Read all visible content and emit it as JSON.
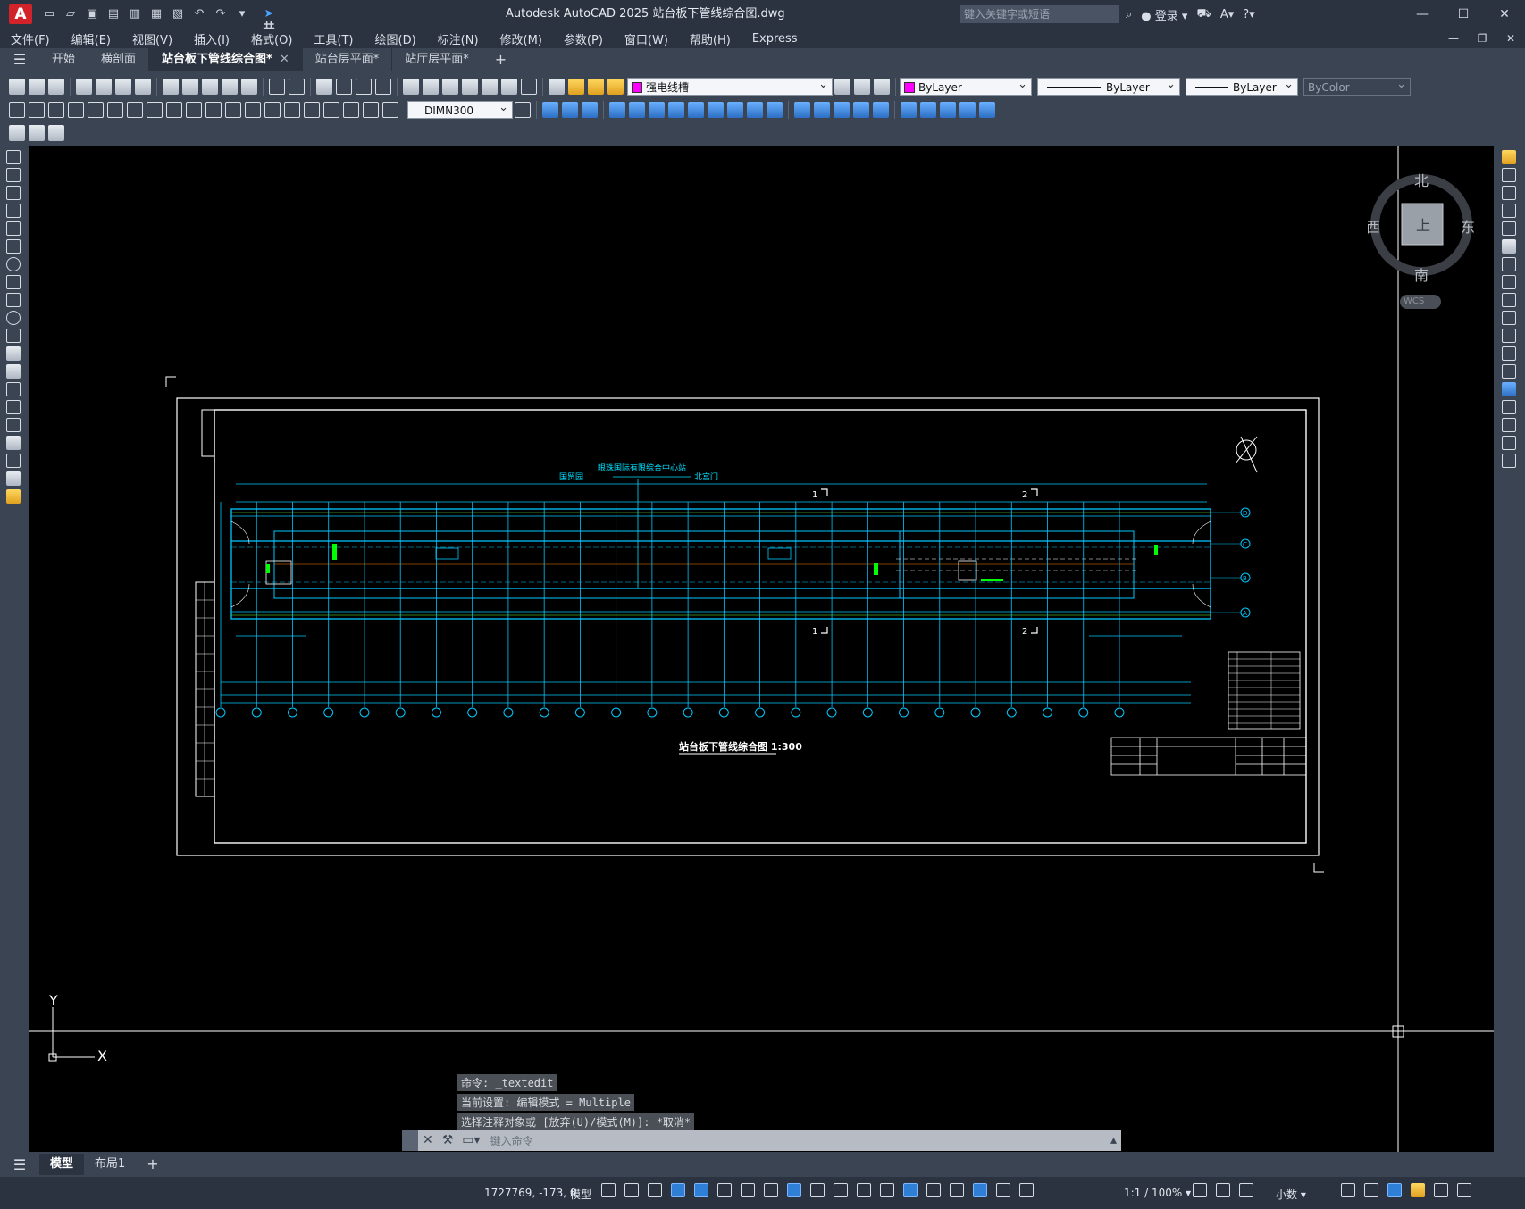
{
  "app": {
    "logo": "A",
    "title": "Autodesk AutoCAD 2025     站台板下管线综合图.dwg",
    "share_label": "共享",
    "search_placeholder": "键入关键字或短语",
    "login_label": "登录"
  },
  "menu": [
    "文件(F)",
    "编辑(E)",
    "视图(V)",
    "插入(I)",
    "格式(O)",
    "工具(T)",
    "绘图(D)",
    "标注(N)",
    "修改(M)",
    "参数(P)",
    "窗口(W)",
    "帮助(H)",
    "Express"
  ],
  "tabs": [
    {
      "label": "开始",
      "active": false
    },
    {
      "label": "横剖面",
      "active": false
    },
    {
      "label": "站台板下管线综合图*",
      "active": true
    },
    {
      "label": "站台层平面*",
      "active": false
    },
    {
      "label": "站厅层平面*",
      "active": false
    }
  ],
  "toolbar": {
    "layer_name": "强电线槽",
    "color": "ByLayer",
    "linetype": "ByLayer",
    "lineweight": "ByLayer",
    "plotstyle": "ByColor",
    "dimstyle": "DIMN300"
  },
  "viewcube": {
    "north": "北",
    "south": "南",
    "east": "东",
    "west": "西",
    "top": "上",
    "wcs": "WCS"
  },
  "drawing": {
    "title": "站台板下管线综合图 1:300",
    "top_label_left": "国贸园",
    "top_label_mid": "眼珠国际有限综合中心站",
    "top_label_right": "北宫门",
    "section1": "1",
    "section2": "2",
    "axis_labels": [
      "①",
      "②",
      "③",
      "④",
      "⑤",
      "⑥",
      "⑦",
      "⑧",
      "⑨",
      "⑩",
      "⑪",
      "⑫",
      "⑬",
      "⑭",
      "⑮",
      "⑯",
      "⑰",
      "⑱",
      "⑲",
      "⑳",
      "㉑",
      "㉒",
      "㉓",
      "㉔",
      "㉕",
      "㉖"
    ],
    "row_labels": [
      "D",
      "C",
      "B",
      "A"
    ]
  },
  "ucs": {
    "x": "X",
    "y": "Y"
  },
  "command": {
    "history": [
      "命令: _textedit",
      "当前设置: 编辑模式 = Multiple",
      "选择注释对象或 [放弃(U)/模式(M)]: *取消*"
    ],
    "placeholder": "键入命令"
  },
  "layouts": [
    {
      "label": "模型",
      "active": true
    },
    {
      "label": "布局1",
      "active": false
    }
  ],
  "status": {
    "coords": "1727769, -173, 0",
    "mode": "模型",
    "scale": "1:1 / 100%",
    "units": "小数"
  },
  "colors": {
    "accent": "#2f7fd6",
    "canvas": "#000000",
    "cyan": "#00c8ff",
    "frame": "#ffffff"
  }
}
